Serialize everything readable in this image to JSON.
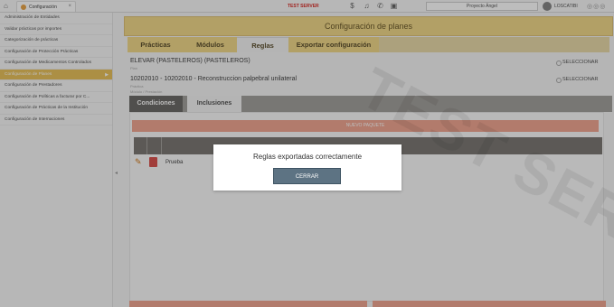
{
  "topbar": {
    "tab_label": "Configuración",
    "server_label": "TEST SERVER",
    "project": "Proyecto Ángel",
    "user": "LOSCATIBI"
  },
  "sidebar": {
    "items": [
      {
        "label": "Administración de Entidades"
      },
      {
        "label": "Validar prácticas por importes"
      },
      {
        "label": "Categorización de prácticas"
      },
      {
        "label": "Configuración de Protección Prácticas"
      },
      {
        "label": "Configuración de Medicamentos Controlados"
      },
      {
        "label": "Configuración de Planes"
      },
      {
        "label": "Configuración de Prestadores"
      },
      {
        "label": "Configuración de Políticas a facturar por C..."
      },
      {
        "label": "Configuración de Prácticas de la Institución"
      },
      {
        "label": "Configuración de Internaciones"
      }
    ],
    "active_index": 5
  },
  "header": {
    "title": "Configuración de planes"
  },
  "tabs": [
    "Prácticas",
    "Módulos",
    "Reglas",
    "Exportar configuración"
  ],
  "selected_tab": "Reglas",
  "plan": {
    "name": "ELEVAR (PASTELEROS) (PASTELEROS)",
    "name_caption": "Plan",
    "practice": "10202010 - 10202010 - Reconstruccion palpebral unilateral",
    "practice_caption": "Práctica",
    "extra_caption": "Módulo / Prestación",
    "select_label": "SELECCIONAR"
  },
  "subtabs": [
    "Condiciones",
    "Inclusiones"
  ],
  "new_package_label": "NUEVO PAQUETE",
  "rows": [
    {
      "name": "Prueba"
    }
  ],
  "watermark": "TEST SERVER",
  "modal": {
    "message": "Reglas exportadas correctamente",
    "button": "CERRAR"
  },
  "colors": {
    "header_bg": "#f0d88a",
    "active_sidebar": "#e8c25c",
    "accent_salmon": "#f0a692",
    "modal_button": "#5d7383"
  }
}
